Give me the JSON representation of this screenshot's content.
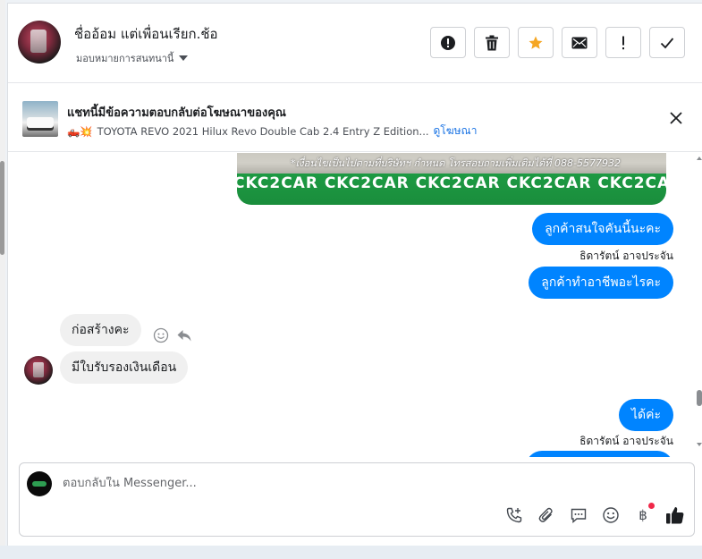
{
  "header": {
    "contact_name": "ชื่ออ้อม แต่เพื่อนเรียก.ช้อ",
    "assign_label": "มอบหมายการสนทนานี้",
    "actions": [
      {
        "icon": "alert-circle-icon",
        "name": "spam-button"
      },
      {
        "icon": "trash-icon",
        "name": "delete-button"
      },
      {
        "icon": "star-icon",
        "name": "star-button"
      },
      {
        "icon": "envelope-icon",
        "name": "mark-unread-button"
      },
      {
        "icon": "exclamation-icon",
        "name": "follow-up-button"
      },
      {
        "icon": "check-icon",
        "name": "mark-done-button"
      }
    ]
  },
  "ad": {
    "title": "แชทนี้มีข้อความตอบกลับต่อโฆษณาของคุณ",
    "emoji": "🛻💥",
    "description": "TOYOTA REVO 2021 Hilux Revo Double Cab 2.4 Entry Z Edition...",
    "link_label": "ดูโฆษณา"
  },
  "chat": {
    "image_note": "*เงื่อนไขเป็นไปตามที่บริษัทฯ กำหนด โทรสอบถามเพิ่มเติมได้ที่ 088-5577932",
    "image_brand": "CKC2CAR CKC2CAR CKC2CAR CKC2CAR CKC2CAR CKC2",
    "messages": [
      {
        "text": "ลูกค้าสนใจคันนี้นะคะ"
      },
      {
        "text": "ลูกค้าทำอาชีพอะไรคะ"
      },
      {
        "text": "ก่อสร้างคะ"
      },
      {
        "text": "มีใบรับรองเงินเดือน"
      },
      {
        "text": "ได้ค่ะ"
      }
    ],
    "sender_1": "ธิดารัตน์ อาจประจัน",
    "sender_2": "ธิดารัตน์ อาจประจัน"
  },
  "composer": {
    "placeholder": "ตอบกลับใน Messenger...",
    "tools": [
      "phone-plus-icon",
      "paperclip-icon",
      "chat-bubble-icon",
      "smiley-icon",
      "baht-icon",
      "thumbs-up-icon"
    ],
    "baht_symbol": "฿"
  },
  "colors": {
    "accent": "#0084ff",
    "star": "#f5a623",
    "notify": "#f02849"
  }
}
